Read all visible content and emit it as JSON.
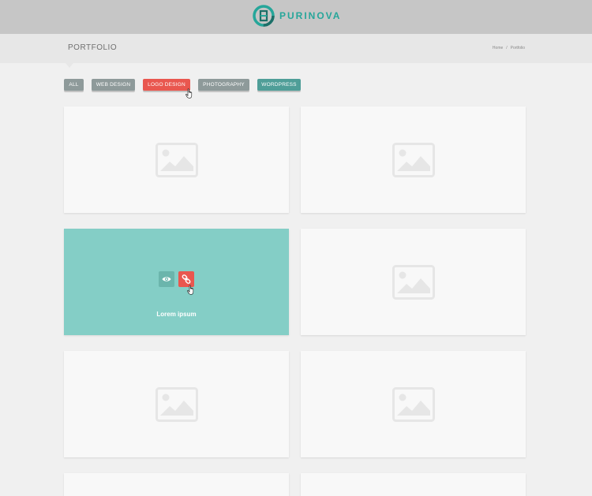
{
  "colors": {
    "accent": "#26a69a",
    "active_filter": "#e9574f",
    "hover_overlay": "#84cec6",
    "filter_default": "#8e9a9a",
    "filter_wordpress": "#4f9e98"
  },
  "header": {
    "brand_name": "PURINOVA",
    "logo_icon": "purinova-logo-icon"
  },
  "titlebar": {
    "title": "PORTFOLIO",
    "breadcrumb": {
      "home": "Home",
      "separator": "/",
      "current": "Portfolio"
    }
  },
  "filters": {
    "active": "LOGO DESIGN",
    "items": [
      {
        "label": "ALL"
      },
      {
        "label": "WEB DESIGN"
      },
      {
        "label": "LOGO DESIGN"
      },
      {
        "label": "PHOTOGRAPHY"
      },
      {
        "label": "WORDPRESS"
      }
    ]
  },
  "portfolio": {
    "hovered_item": {
      "caption": "Lorem ipsum",
      "view_icon": "eye-icon",
      "link_icon": "link-icon"
    },
    "placeholder_icon": "image-placeholder-icon"
  }
}
